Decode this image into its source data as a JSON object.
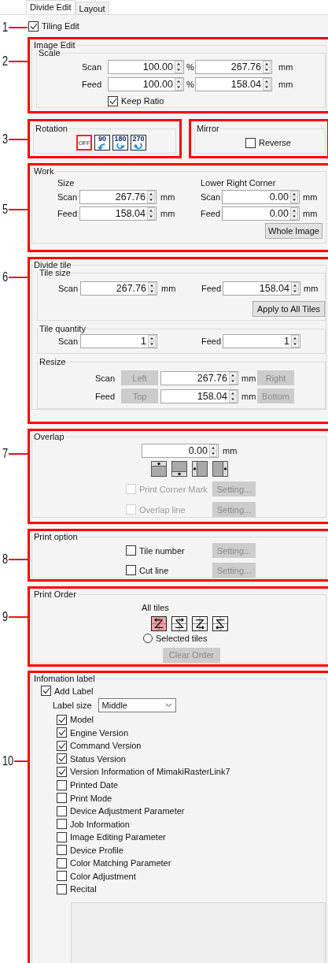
{
  "tabs": [
    {
      "label": "Divide Edit",
      "selected": true
    },
    {
      "label": "Layout",
      "selected": false
    }
  ],
  "tiling_edit": {
    "callout": "1",
    "label": "Tiling Edit",
    "checked": true
  },
  "image_edit": {
    "callout": "2",
    "title": "Image Edit",
    "scale": {
      "title": "Scale",
      "rows": [
        {
          "label": "Scan",
          "percent": "100.00",
          "percent_unit": "%",
          "length": "267.76",
          "length_unit": "mm"
        },
        {
          "label": "Feed",
          "percent": "100.00",
          "percent_unit": "%",
          "length": "158.04",
          "length_unit": "mm"
        }
      ],
      "keep_ratio": {
        "label": "Keep Ratio",
        "checked": true
      }
    }
  },
  "rotation": {
    "callout": "3",
    "title": "Rotation",
    "options": [
      {
        "label": "OFF",
        "kind": "off",
        "selected": true
      },
      {
        "label": "90",
        "kind": "rotate",
        "selected": false
      },
      {
        "label": "180",
        "kind": "rotate",
        "selected": false
      },
      {
        "label": "270",
        "kind": "rotate",
        "selected": false
      }
    ]
  },
  "mirror": {
    "title": "Mirror",
    "reverse": {
      "label": "Reverse",
      "checked": false
    }
  },
  "work": {
    "callout": "5",
    "title": "Work",
    "size_title": "Size",
    "corner_title": "Lower Right Corner",
    "rows": [
      {
        "label": "Scan",
        "size": "267.76",
        "size_unit": "mm",
        "corner_label": "Scan",
        "corner": "0.00",
        "corner_unit": "mm"
      },
      {
        "label": "Feed",
        "size": "158.04",
        "size_unit": "mm",
        "corner_label": "Feed",
        "corner": "0.00",
        "corner_unit": "mm"
      }
    ],
    "button": {
      "label": "Whole Image",
      "disabled": false
    }
  },
  "divide_tile": {
    "callout": "6",
    "title": "Divide tile",
    "tile_size": {
      "title": "Tile size",
      "scan": {
        "label": "Scan",
        "value": "267.76",
        "unit": "mm"
      },
      "feed": {
        "label": "Feed",
        "value": "158.04",
        "unit": "mm"
      },
      "button": {
        "label": "Apply to All Tiles",
        "disabled": false
      }
    },
    "tile_quantity": {
      "title": "Tile quantity",
      "scan": {
        "label": "Scan",
        "value": "1"
      },
      "feed": {
        "label": "Feed",
        "value": "1"
      }
    },
    "resize": {
      "title": "Resize",
      "rows": [
        {
          "label": "Scan",
          "before": {
            "label": "Left",
            "disabled": true
          },
          "value": "267.76",
          "unit": "mm",
          "after": {
            "label": "Right",
            "disabled": true
          }
        },
        {
          "label": "Feed",
          "before": {
            "label": "Top",
            "disabled": true
          },
          "value": "158.04",
          "unit": "mm",
          "after": {
            "label": "Bottom",
            "disabled": true
          }
        }
      ]
    }
  },
  "overlap": {
    "callout": "7",
    "title": "Overlap",
    "value": "0.00",
    "unit": "mm",
    "options": [
      {
        "label": "Print Corner Mark",
        "checked": false,
        "disabled": true,
        "button": {
          "label": "Setting...",
          "disabled": true
        }
      },
      {
        "label": "Overlap line",
        "checked": false,
        "disabled": true,
        "button": {
          "label": "Setting...",
          "disabled": true
        }
      }
    ]
  },
  "print_option": {
    "callout": "8",
    "title": "Print option",
    "options": [
      {
        "label": "Tile number",
        "checked": false,
        "disabled": false,
        "button": {
          "label": "Setting...",
          "disabled": true
        }
      },
      {
        "label": "Cut line",
        "checked": false,
        "disabled": false,
        "button": {
          "label": "Setting...",
          "disabled": true
        }
      }
    ]
  },
  "print_order": {
    "callout": "9",
    "title": "Print Order",
    "all_tiles": "All tiles",
    "orders": [
      {
        "selected": true
      },
      {
        "selected": false
      },
      {
        "selected": false
      },
      {
        "selected": false
      }
    ],
    "selected_tiles": {
      "label": "Selected tiles",
      "selected": false
    },
    "button": {
      "label": "Clear Order",
      "disabled": true
    }
  },
  "information_label": {
    "callout": "10",
    "title": "Infomation label",
    "add_label": {
      "label": "Add Label",
      "checked": true
    },
    "label_size": {
      "label": "Label size",
      "value": "Middle"
    },
    "items": [
      {
        "label": "Model",
        "checked": true
      },
      {
        "label": "Engine Version",
        "checked": true
      },
      {
        "label": "Command Version",
        "checked": true
      },
      {
        "label": "Status Version",
        "checked": true
      },
      {
        "label": "Version Information of MimakiRasterLink7",
        "checked": true
      },
      {
        "label": "Printed Date",
        "checked": false
      },
      {
        "label": "Print Mode",
        "checked": false
      },
      {
        "label": "Device Adjustment Parameter",
        "checked": false
      },
      {
        "label": "Job Information",
        "checked": false
      },
      {
        "label": "Image Editing Parameter",
        "checked": false
      },
      {
        "label": "Device Profile",
        "checked": false
      },
      {
        "label": "Color Matching Parameter",
        "checked": false
      },
      {
        "label": "Color Adjustment",
        "checked": false
      },
      {
        "label": "Recital",
        "checked": false
      }
    ]
  }
}
